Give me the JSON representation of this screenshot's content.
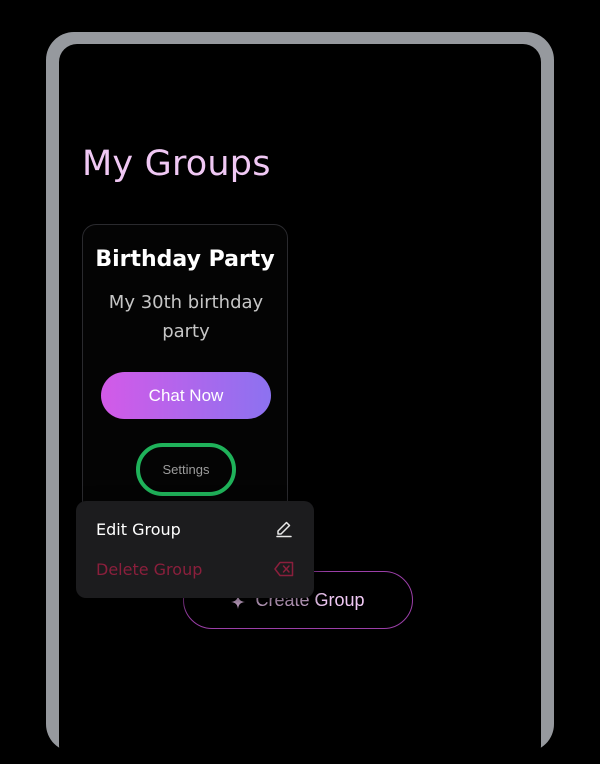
{
  "page": {
    "title": "My Groups"
  },
  "group_card": {
    "title": "Birthday Party",
    "description": "My 30th birthday party",
    "chat_button_label": "Chat Now",
    "settings_label": "Settings"
  },
  "dropdown": {
    "items": [
      {
        "label": "Edit Group",
        "icon": "pencil-icon"
      },
      {
        "label": "Delete Group",
        "icon": "backspace-delete-icon"
      }
    ]
  },
  "create_button": {
    "label": "Create Group",
    "icon": "sparkle-icon"
  },
  "colors": {
    "title": "#f0c8f4",
    "chat_gradient_start": "#d35ae8",
    "chat_gradient_end": "#8c72f0",
    "settings_highlight": "#1fb25a",
    "delete": "#8a1f3c",
    "create_border": "#9b3fa8",
    "frame": "#96999e"
  }
}
